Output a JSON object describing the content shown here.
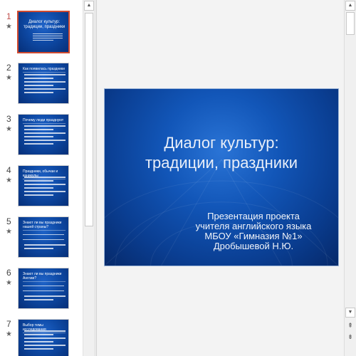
{
  "thumbnails": [
    {
      "number": "1",
      "selected": true,
      "title": "Диалог культур: традиции, праздники",
      "style": "title"
    },
    {
      "number": "2",
      "selected": false,
      "title": "Как появилась праздники",
      "style": "bullets"
    },
    {
      "number": "3",
      "selected": false,
      "title": "Почему люди празднуют",
      "style": "bullets"
    },
    {
      "number": "4",
      "selected": false,
      "title": "Праздники, обычаи и каникулы",
      "style": "bullets"
    },
    {
      "number": "5",
      "selected": false,
      "title": "Знают ли вы праздники нашей страны?",
      "style": "table"
    },
    {
      "number": "6",
      "selected": false,
      "title": "Знают ли вы праздники Англии?",
      "style": "table"
    },
    {
      "number": "7",
      "selected": false,
      "title": "Выбор темы исследования",
      "style": "bullets"
    }
  ],
  "thumbnail_star": "★",
  "slide": {
    "title_line1": "Диалог культур:",
    "title_line2": "традиции, праздники",
    "subtitle_line1": "Презентация проекта",
    "subtitle_line2": "учителя английского языка",
    "subtitle_line3": "МБОУ «Гимназия №1»",
    "subtitle_line4": "Дробышевой Н.Ю."
  },
  "scroll": {
    "up_arrow": "▲",
    "down_arrow": "▼",
    "prev_slide": "⇞",
    "next_slide": "⇟"
  },
  "colors": {
    "slide_background": "#0e4aa6",
    "selected_border": "#d04a2f",
    "selected_number": "#c0504d"
  }
}
